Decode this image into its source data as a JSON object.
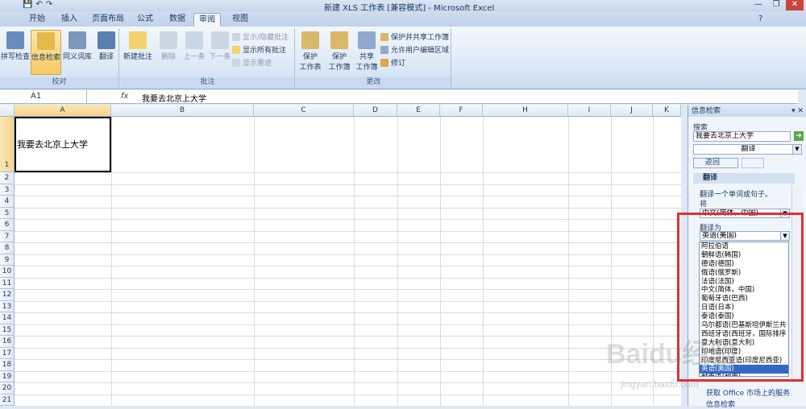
{
  "window": {
    "title": "新建 XLS 工作表 [兼容模式] - Microsoft Excel",
    "controls": [
      "—",
      "❐",
      "✕"
    ]
  },
  "tabs": [
    "开始",
    "插入",
    "页面布局",
    "公式",
    "数据",
    "审阅",
    "视图"
  ],
  "active_tab": "审阅",
  "ribbon": {
    "proofing": {
      "label": "校对",
      "buttons": [
        "拼写检查",
        "信息检索",
        "同义词库",
        "翻译"
      ]
    },
    "comments": {
      "label": "批注",
      "buttons": [
        "新建批注",
        "删除",
        "上一条",
        "下一条"
      ],
      "small": [
        "显示/隐藏批注",
        "显示所有批注",
        "显示墨迹"
      ]
    },
    "changes": {
      "label": "更改",
      "protect_sheet": "保护\n工作表",
      "protect_book": "保护\n工作簿",
      "share_book": "共享\n工作簿",
      "small": [
        "保护并共享工作簿",
        "允许用户编辑区域",
        "修订"
      ]
    }
  },
  "formula_bar": {
    "name_box": "A1",
    "fx": "fx",
    "value": "我要去北京上大学"
  },
  "sheet": {
    "columns": [
      "A",
      "B",
      "C",
      "D",
      "E",
      "F",
      "H",
      "I",
      "J",
      "K"
    ],
    "rows": [
      "1",
      "2",
      "3",
      "4",
      "5",
      "6",
      "7",
      "8",
      "9",
      "10",
      "11",
      "12",
      "13",
      "14",
      "15",
      "16",
      "17",
      "18",
      "19",
      "20",
      "21"
    ],
    "cell_a1": "我要去北京上大学"
  },
  "research_pane": {
    "header": "信息检索",
    "search_label": "搜索",
    "search_value": "我要去北京上大学",
    "service": "翻译",
    "back_label": "返回",
    "section_title": "翻译",
    "desc": "翻译一个单词或句子。",
    "from_label": "将",
    "from_value": "中文(简体，中国)",
    "to_label": "翻译为",
    "to_value": "英语(美国)",
    "languages": [
      "阿拉伯语",
      "朝鲜语(韩国)",
      "德语(德国)",
      "俄语(俄罗斯)",
      "法语(法国)",
      "中文(简体，中国)",
      "葡萄牙语(巴西)",
      "日语(日本)",
      "泰语(泰国)",
      "乌尔都语(巴基斯坦伊斯兰共",
      "西班牙语(西班牙，国际排序",
      "意大利语(意大利)",
      "印地语(印度)",
      "印度尼西亚语(印度尼西亚)",
      "英语(美国)",
      "越南语(越南)"
    ],
    "selected_language": "英语(美国)",
    "footer_link": "获取 Office 市场上的服务",
    "footer2": "信息检索"
  },
  "watermark": "Baidu经验",
  "watermark_url": "jingyan.baidu.com"
}
